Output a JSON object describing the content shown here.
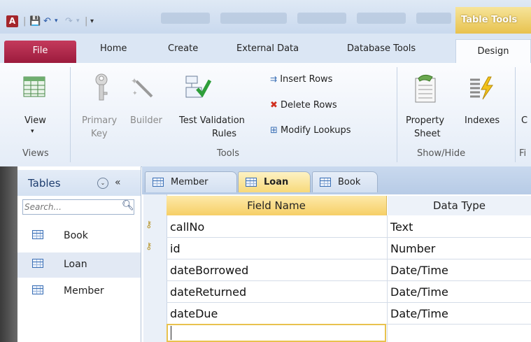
{
  "window": {
    "title_context_tab": "Table Tools",
    "logo_text": "A"
  },
  "ribbon_tabs": [
    "File",
    "Home",
    "Create",
    "External Data",
    "Database Tools",
    "Design"
  ],
  "ribbon": {
    "view": {
      "label": "View",
      "dropdown": "▾"
    },
    "primary_key": {
      "line1": "Primary",
      "line2": "Key"
    },
    "builder": {
      "label": "Builder"
    },
    "test_validation": {
      "line1": "Test Validation",
      "line2": "Rules"
    },
    "insert_rows": "Insert Rows",
    "delete_rows": "Delete Rows",
    "modify_lookups": "Modify Lookups",
    "property_sheet": {
      "line1": "Property",
      "line2": "Sheet"
    },
    "indexes": "Indexes",
    "cut_c": "C",
    "groups": {
      "views": "Views",
      "tools": "Tools",
      "show_hide": "Show/Hide",
      "fi": "Fi"
    }
  },
  "nav": {
    "title": "Tables",
    "dropdown_icon": "⌄",
    "collapse_icon": "«",
    "search_placeholder": "Search...",
    "items": [
      {
        "label": "Book",
        "selected": false
      },
      {
        "label": "Loan",
        "selected": true
      },
      {
        "label": "Member",
        "selected": false
      }
    ]
  },
  "doc_tabs": [
    {
      "label": "Member",
      "active": false
    },
    {
      "label": "Loan",
      "active": true
    },
    {
      "label": "Book",
      "active": false
    }
  ],
  "grid": {
    "headers": {
      "field_name": "Field Name",
      "data_type": "Data Type"
    },
    "rows": [
      {
        "field": "callNo",
        "type": "Text",
        "primary_key": true
      },
      {
        "field": "id",
        "type": "Number",
        "primary_key": true
      },
      {
        "field": "dateBorrowed",
        "type": "Date/Time",
        "primary_key": false
      },
      {
        "field": "dateReturned",
        "type": "Date/Time",
        "primary_key": false
      },
      {
        "field": "dateDue",
        "type": "Date/Time",
        "primary_key": false
      }
    ]
  },
  "colors": {
    "file_tab": "#9c1b3d",
    "context_tab": "#e8c24e",
    "accent": "#3a6fb5"
  }
}
